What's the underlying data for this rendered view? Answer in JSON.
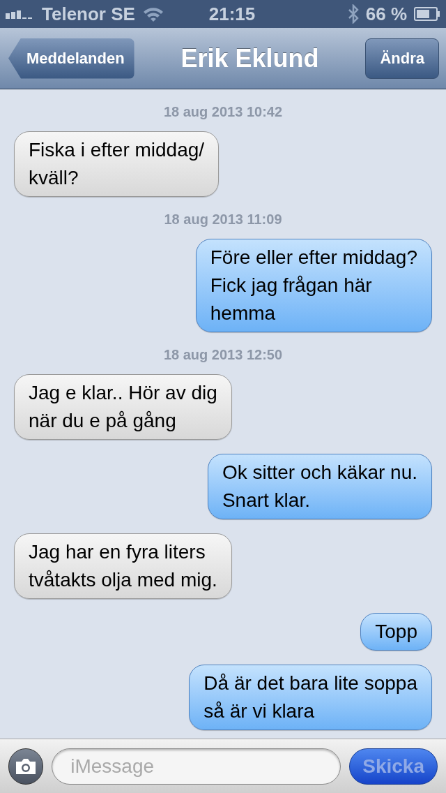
{
  "status_bar": {
    "carrier": "Telenor SE",
    "time": "21:15",
    "battery": "66 %"
  },
  "nav": {
    "back": "Meddelanden",
    "title": "Erik Eklund",
    "edit": "Ändra"
  },
  "messages": [
    {
      "kind": "timestamp",
      "text": "18 aug 2013 10:42"
    },
    {
      "kind": "received",
      "text": "Fiska i efter middag/\nkväll?"
    },
    {
      "kind": "timestamp",
      "text": "18 aug 2013 11:09"
    },
    {
      "kind": "sent",
      "text": "Före eller efter middag?\nFick jag frågan här\nhemma"
    },
    {
      "kind": "timestamp",
      "text": "18 aug 2013 12:50"
    },
    {
      "kind": "received",
      "text": "Jag e klar.. Hör av dig\nnär du e på gång"
    },
    {
      "kind": "sent",
      "text": "Ok sitter och käkar nu.\nSnart klar."
    },
    {
      "kind": "received",
      "text": "Jag har en fyra liters\ntvåtakts olja med mig."
    },
    {
      "kind": "sent",
      "text": "Topp"
    },
    {
      "kind": "sent",
      "text": "Då är det bara lite soppa\nså är vi klara"
    }
  ],
  "composer": {
    "placeholder": "iMessage",
    "send": "Skicka",
    "send_disabled": true
  }
}
